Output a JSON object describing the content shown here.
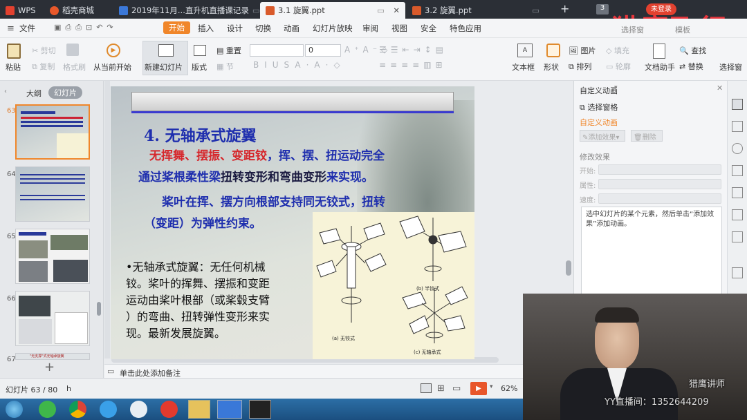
{
  "tabs": [
    {
      "label": "WPS",
      "active": false
    },
    {
      "label": "稻壳商城",
      "active": false
    },
    {
      "label": "2019年11月...直升机直播课记录",
      "active": false
    },
    {
      "label": "3.1 旋翼.ppt",
      "active": true
    },
    {
      "label": "3.2 旋翼.ppt",
      "active": false
    }
  ],
  "tab_badge": "3",
  "login_label": "未登录",
  "menu": {
    "file": "文件",
    "items": [
      "开始",
      "插入",
      "设计",
      "切换",
      "动画",
      "幻灯片放映",
      "审阅",
      "视图",
      "安全",
      "特色应用"
    ],
    "active": "开始"
  },
  "ribbon": {
    "paste": "粘贴",
    "cut": "剪切",
    "copy": "复制",
    "format_painter": "格式刷",
    "from_current": "从当前开始",
    "new_slide": "新建幻灯片",
    "layout": "版式",
    "reset": "重置",
    "section": "节",
    "font_size_value": "0",
    "textbox": "文本框",
    "shape": "形状",
    "picture": "图片",
    "arrange": "排列",
    "fill": "填充",
    "outline": "轮廓",
    "doc_helper": "文档助手",
    "find": "查找",
    "replace": "替换",
    "select_pane": "选择窗",
    "template": "模板"
  },
  "left_pane": {
    "tab_outline": "大纲",
    "tab_slides": "幻灯片",
    "thumbs": [
      {
        "num": "63",
        "selected": true
      },
      {
        "num": "64",
        "selected": false
      },
      {
        "num": "65",
        "selected": false
      },
      {
        "num": "66",
        "selected": false
      },
      {
        "num": "67",
        "selected": false
      }
    ],
    "thumb67_caption": "\"无支撑\"式无轴承旋翼"
  },
  "slide": {
    "title": "4.  无轴承式旋翼",
    "para1_l1_red": "无挥舞、摆振、变距铰",
    "para1_l1_blue": "，挥、摆、扭运动完全",
    "para1_l2_a": "通过桨根柔性梁",
    "para1_l2_b": "扭转变形和弯曲变形",
    "para1_l2_c": "来实现。",
    "para2_l1": "桨叶在挥、摆方向根部支持同无铰式，扭转",
    "para2_l2": "（变距）为弹性约束。",
    "bullet_lines": [
      "•无轴承式旋翼：无任何机械",
      "铰。桨叶的挥舞、摆振和变距",
      "运动由桨叶根部（或桨毂支臂",
      "）的弯曲、扭转弹性变形来实",
      "现。最新发展旋翼。"
    ],
    "fig_labels": {
      "a": "(a)    无铰式",
      "b": "(b)    半铰式",
      "c": "(c)    无轴承式"
    }
  },
  "notes_placeholder": "单击此处添加备注",
  "right_pane": {
    "title": "自定义动画",
    "select_pane": "选择窗格",
    "section": "自定义动画",
    "add_effect": "添加效果",
    "delete": "删除",
    "modify": "修改效果",
    "start": "开始:",
    "property": "属性:",
    "speed": "速度:",
    "hint": "选中幻灯片的某个元素，然后单击“添加效果”添加动画。"
  },
  "status": {
    "slide_info": "幻灯片 63 / 80",
    "extra": "h",
    "zoom": "62%"
  },
  "video_overlay": {
    "name": "猎鹰讲师",
    "contact": "YY直播间：1352644209"
  },
  "watermark": "猎鹰飞行",
  "colors": {
    "accent": "#f0862a",
    "title_blue": "#1f2fae",
    "title_red": "#d6262b",
    "taskbar": "#1f5a8f"
  }
}
